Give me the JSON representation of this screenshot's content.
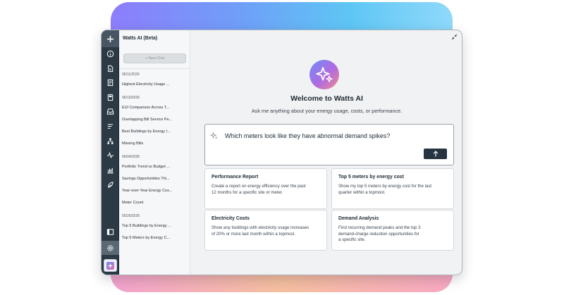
{
  "app": {
    "title": "Watts AI (Beta)"
  },
  "sidebar": {
    "new_chat_label": "+ New Chat",
    "groups": [
      {
        "date": "06/11/2026",
        "items": [
          "Highest Electricity Usage ..."
        ]
      },
      {
        "date": "06/10/2026",
        "items": [
          "EUI Comparison Across T...",
          "Overlapping Bill Service Pe...",
          "Best Buildings by Energy I...",
          "Missing Bills"
        ]
      },
      {
        "date": "06/04/2026",
        "items": [
          "Portfolio Trend vs Budget ...",
          "Savings Opportunities Thi...",
          "Year-over-Year Energy Cos...",
          "Meter Count"
        ]
      },
      {
        "date": "05/26/2026",
        "items": [
          "Top 5 Buildings by Energy ...",
          "Top 5 Meters by Energy C..."
        ]
      }
    ]
  },
  "rail_icons": [
    "plus-icon",
    "info-icon",
    "document-icon",
    "bills-icon",
    "meter-icon",
    "inbox-icon",
    "list-icon",
    "hierarchy-icon",
    "pulse-icon",
    "chart-icon",
    "leaf-icon",
    "panel-icon",
    "gear-icon",
    "ai-sparkle-icon"
  ],
  "main": {
    "welcome": "Welcome to Watts AI",
    "subtitle": "Ask me anything about your energy usage, costs, or performance.",
    "prompt_value": "Which meters look like they have abnormal demand spikes?",
    "send_icon": "arrow-up-icon",
    "cards": [
      {
        "title": "Performance Report",
        "lines": [
          "Create a report on energy efficiency over the past",
          "12 months for a specific site or meter."
        ]
      },
      {
        "title": "Top 5 meters by energy cost",
        "lines": [
          "Show my top 5 meters by energy cost for the last",
          "quarter within a topmost."
        ]
      },
      {
        "title": "Electricity Costs",
        "lines": [
          "Show any buildings with electricity usage increases",
          "of 20% or more last month within a topmost."
        ]
      },
      {
        "title": "Demand Analysis",
        "lines": [
          "Find recurring demand peaks and the top 3",
          "demand-charge reduction opportunities for",
          "a specific site."
        ]
      }
    ]
  },
  "colors": {
    "rail": "#2b3a45",
    "accent_dark": "#253440",
    "logo_start": "#6e8cf9",
    "logo_end": "#f28a8c"
  }
}
